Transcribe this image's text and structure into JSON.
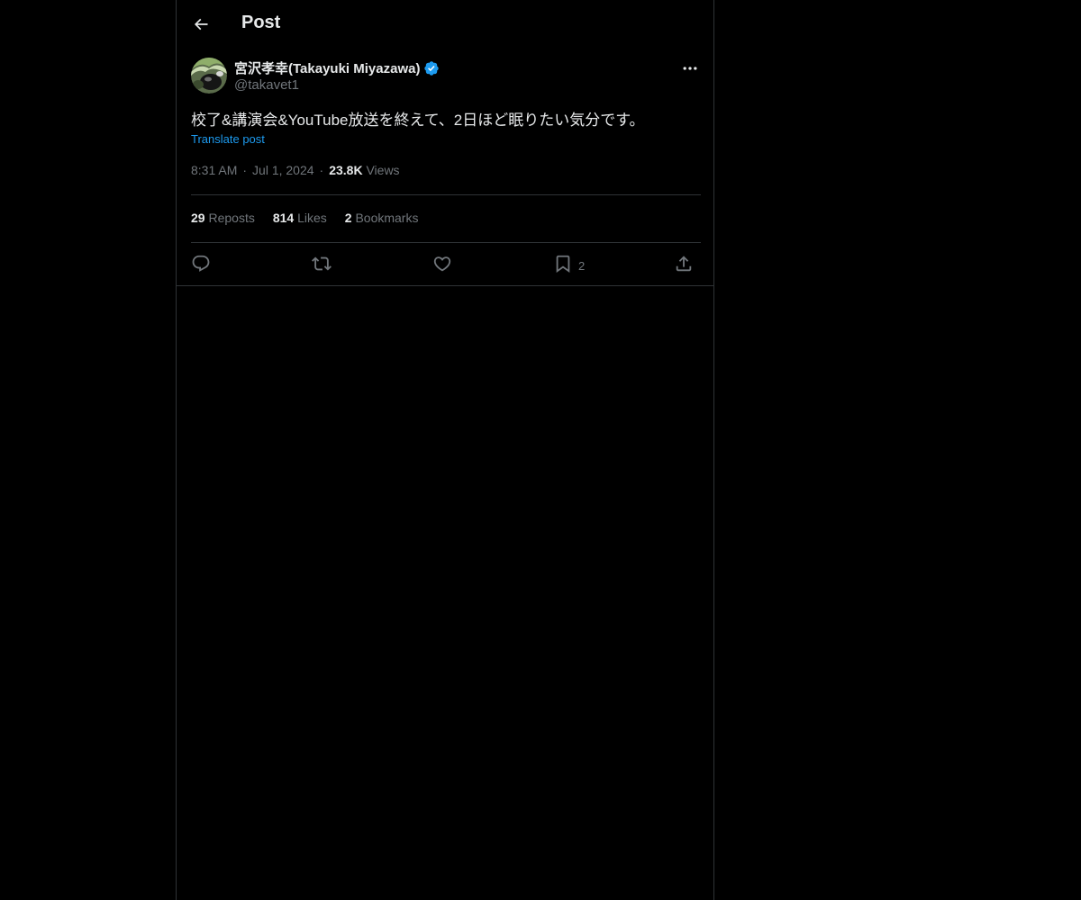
{
  "header": {
    "title": "Post"
  },
  "post": {
    "author": {
      "display_name": "宮沢孝幸(Takayuki Miyazawa)",
      "handle": "@takavet1",
      "verified": true
    },
    "text": "校了&講演会&YouTube放送を終えて、2日ほど眠りたい気分です。",
    "translate_label": "Translate post",
    "time": "8:31 AM",
    "date": "Jul 1, 2024",
    "separator": "·",
    "views_count": "23.8K",
    "views_label": "Views"
  },
  "stats": {
    "reposts_count": "29",
    "reposts_label": "Reposts",
    "likes_count": "814",
    "likes_label": "Likes",
    "bookmarks_count": "2",
    "bookmarks_label": "Bookmarks"
  },
  "actions": {
    "reply_icon": "reply-icon",
    "repost_icon": "repost-icon",
    "like_icon": "heart-icon",
    "bookmark_icon": "bookmark-icon",
    "bookmark_count": "2",
    "share_icon": "share-icon"
  },
  "colors": {
    "background": "#000000",
    "text_primary": "#e7e9ea",
    "text_secondary": "#71767b",
    "accent": "#1d9bf0",
    "border": "#2f3336"
  }
}
